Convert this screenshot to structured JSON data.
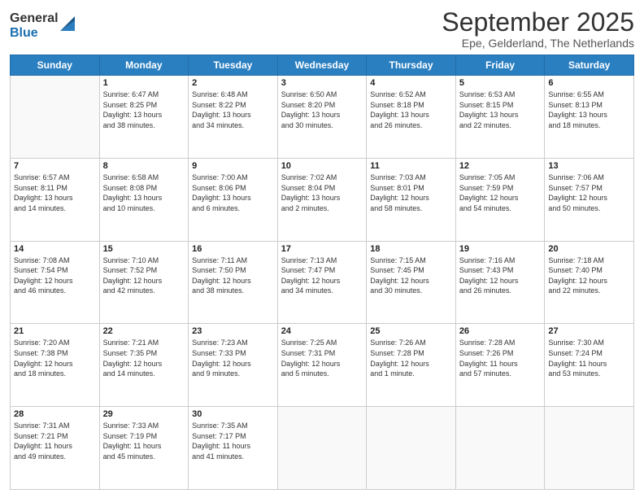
{
  "logo": {
    "general": "General",
    "blue": "Blue"
  },
  "header": {
    "month_title": "September 2025",
    "subtitle": "Epe, Gelderland, The Netherlands"
  },
  "weekdays": [
    "Sunday",
    "Monday",
    "Tuesday",
    "Wednesday",
    "Thursday",
    "Friday",
    "Saturday"
  ],
  "weeks": [
    [
      {
        "day": "",
        "text": ""
      },
      {
        "day": "1",
        "text": "Sunrise: 6:47 AM\nSunset: 8:25 PM\nDaylight: 13 hours\nand 38 minutes."
      },
      {
        "day": "2",
        "text": "Sunrise: 6:48 AM\nSunset: 8:22 PM\nDaylight: 13 hours\nand 34 minutes."
      },
      {
        "day": "3",
        "text": "Sunrise: 6:50 AM\nSunset: 8:20 PM\nDaylight: 13 hours\nand 30 minutes."
      },
      {
        "day": "4",
        "text": "Sunrise: 6:52 AM\nSunset: 8:18 PM\nDaylight: 13 hours\nand 26 minutes."
      },
      {
        "day": "5",
        "text": "Sunrise: 6:53 AM\nSunset: 8:15 PM\nDaylight: 13 hours\nand 22 minutes."
      },
      {
        "day": "6",
        "text": "Sunrise: 6:55 AM\nSunset: 8:13 PM\nDaylight: 13 hours\nand 18 minutes."
      }
    ],
    [
      {
        "day": "7",
        "text": "Sunrise: 6:57 AM\nSunset: 8:11 PM\nDaylight: 13 hours\nand 14 minutes."
      },
      {
        "day": "8",
        "text": "Sunrise: 6:58 AM\nSunset: 8:08 PM\nDaylight: 13 hours\nand 10 minutes."
      },
      {
        "day": "9",
        "text": "Sunrise: 7:00 AM\nSunset: 8:06 PM\nDaylight: 13 hours\nand 6 minutes."
      },
      {
        "day": "10",
        "text": "Sunrise: 7:02 AM\nSunset: 8:04 PM\nDaylight: 13 hours\nand 2 minutes."
      },
      {
        "day": "11",
        "text": "Sunrise: 7:03 AM\nSunset: 8:01 PM\nDaylight: 12 hours\nand 58 minutes."
      },
      {
        "day": "12",
        "text": "Sunrise: 7:05 AM\nSunset: 7:59 PM\nDaylight: 12 hours\nand 54 minutes."
      },
      {
        "day": "13",
        "text": "Sunrise: 7:06 AM\nSunset: 7:57 PM\nDaylight: 12 hours\nand 50 minutes."
      }
    ],
    [
      {
        "day": "14",
        "text": "Sunrise: 7:08 AM\nSunset: 7:54 PM\nDaylight: 12 hours\nand 46 minutes."
      },
      {
        "day": "15",
        "text": "Sunrise: 7:10 AM\nSunset: 7:52 PM\nDaylight: 12 hours\nand 42 minutes."
      },
      {
        "day": "16",
        "text": "Sunrise: 7:11 AM\nSunset: 7:50 PM\nDaylight: 12 hours\nand 38 minutes."
      },
      {
        "day": "17",
        "text": "Sunrise: 7:13 AM\nSunset: 7:47 PM\nDaylight: 12 hours\nand 34 minutes."
      },
      {
        "day": "18",
        "text": "Sunrise: 7:15 AM\nSunset: 7:45 PM\nDaylight: 12 hours\nand 30 minutes."
      },
      {
        "day": "19",
        "text": "Sunrise: 7:16 AM\nSunset: 7:43 PM\nDaylight: 12 hours\nand 26 minutes."
      },
      {
        "day": "20",
        "text": "Sunrise: 7:18 AM\nSunset: 7:40 PM\nDaylight: 12 hours\nand 22 minutes."
      }
    ],
    [
      {
        "day": "21",
        "text": "Sunrise: 7:20 AM\nSunset: 7:38 PM\nDaylight: 12 hours\nand 18 minutes."
      },
      {
        "day": "22",
        "text": "Sunrise: 7:21 AM\nSunset: 7:35 PM\nDaylight: 12 hours\nand 14 minutes."
      },
      {
        "day": "23",
        "text": "Sunrise: 7:23 AM\nSunset: 7:33 PM\nDaylight: 12 hours\nand 9 minutes."
      },
      {
        "day": "24",
        "text": "Sunrise: 7:25 AM\nSunset: 7:31 PM\nDaylight: 12 hours\nand 5 minutes."
      },
      {
        "day": "25",
        "text": "Sunrise: 7:26 AM\nSunset: 7:28 PM\nDaylight: 12 hours\nand 1 minute."
      },
      {
        "day": "26",
        "text": "Sunrise: 7:28 AM\nSunset: 7:26 PM\nDaylight: 11 hours\nand 57 minutes."
      },
      {
        "day": "27",
        "text": "Sunrise: 7:30 AM\nSunset: 7:24 PM\nDaylight: 11 hours\nand 53 minutes."
      }
    ],
    [
      {
        "day": "28",
        "text": "Sunrise: 7:31 AM\nSunset: 7:21 PM\nDaylight: 11 hours\nand 49 minutes."
      },
      {
        "day": "29",
        "text": "Sunrise: 7:33 AM\nSunset: 7:19 PM\nDaylight: 11 hours\nand 45 minutes."
      },
      {
        "day": "30",
        "text": "Sunrise: 7:35 AM\nSunset: 7:17 PM\nDaylight: 11 hours\nand 41 minutes."
      },
      {
        "day": "",
        "text": ""
      },
      {
        "day": "",
        "text": ""
      },
      {
        "day": "",
        "text": ""
      },
      {
        "day": "",
        "text": ""
      }
    ]
  ]
}
